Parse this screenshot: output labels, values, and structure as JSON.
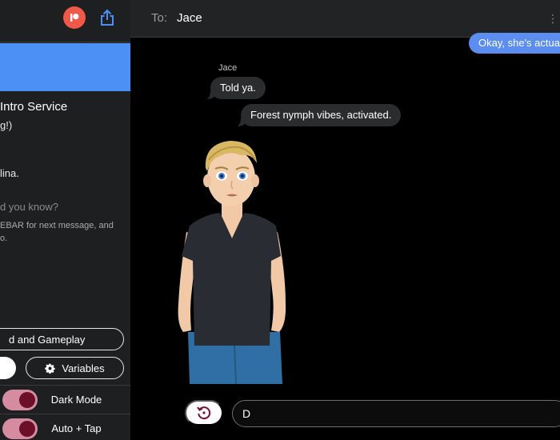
{
  "sidebar": {
    "title": "Intro Service",
    "subtitle": "g!)",
    "author": "lina.",
    "did_you_know": "d you know?",
    "hint_line1": "EBAR for next message, and",
    "hint_line2": "o.",
    "background_button": "d and Gameplay",
    "variables_button": "Variables",
    "toggles": [
      {
        "label": "Dark Mode",
        "on": true
      },
      {
        "label": "Auto + Tap",
        "on": true
      }
    ]
  },
  "header": {
    "to_label": "To:",
    "recipient": "Jace"
  },
  "messages": [
    {
      "from": "me",
      "text": "Okay, she's actual"
    },
    {
      "from": "Jace",
      "sender_label": "Jace",
      "text": "Told ya."
    },
    {
      "from": "Jace",
      "text": "Forest nymph vibes, activated."
    }
  ],
  "composer": {
    "value": "D"
  },
  "colors": {
    "accent_blue": "#4c90f5",
    "sent_bubble": "#5b8ef0",
    "received_bubble": "#2b2c2e",
    "patreon": "#f0584a",
    "toggle_track": "#d68ca0",
    "toggle_knob": "#6b1028"
  },
  "icons": {
    "patreon": "patreon-icon",
    "share": "share-icon",
    "gear": "gear-icon",
    "restart": "restart-icon"
  }
}
